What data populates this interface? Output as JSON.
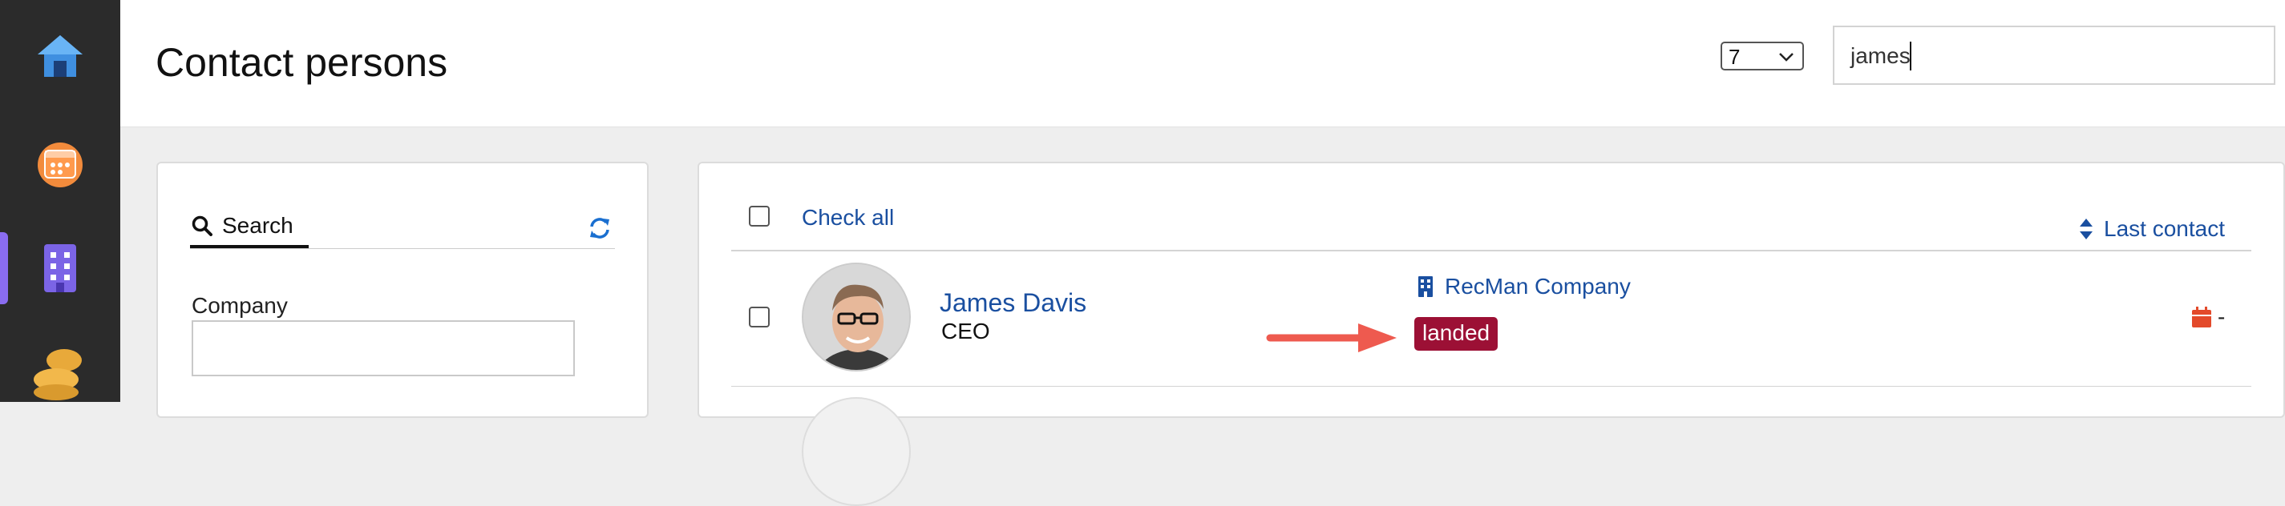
{
  "sidebar": {
    "items": [
      {
        "icon": "home-icon"
      },
      {
        "icon": "calendar-icon"
      },
      {
        "icon": "building-icon",
        "active": true
      },
      {
        "icon": "coins-icon"
      }
    ],
    "active_color": "#8a6cf0"
  },
  "header": {
    "title": "Contact persons",
    "page_size": "7",
    "search_value": "james"
  },
  "filters": {
    "tab_label": "Search",
    "company_label": "Company",
    "company_value": ""
  },
  "list": {
    "check_all_label": "Check all",
    "sort_label": "Last contact",
    "rows": [
      {
        "name": "James Davis",
        "title": "CEO",
        "company": "RecMan Company",
        "status": "landed",
        "status_color": "#9c1035",
        "last_contact": "-"
      }
    ]
  },
  "colors": {
    "link": "#1a4fa0",
    "arrow": "#ee5a4f"
  }
}
